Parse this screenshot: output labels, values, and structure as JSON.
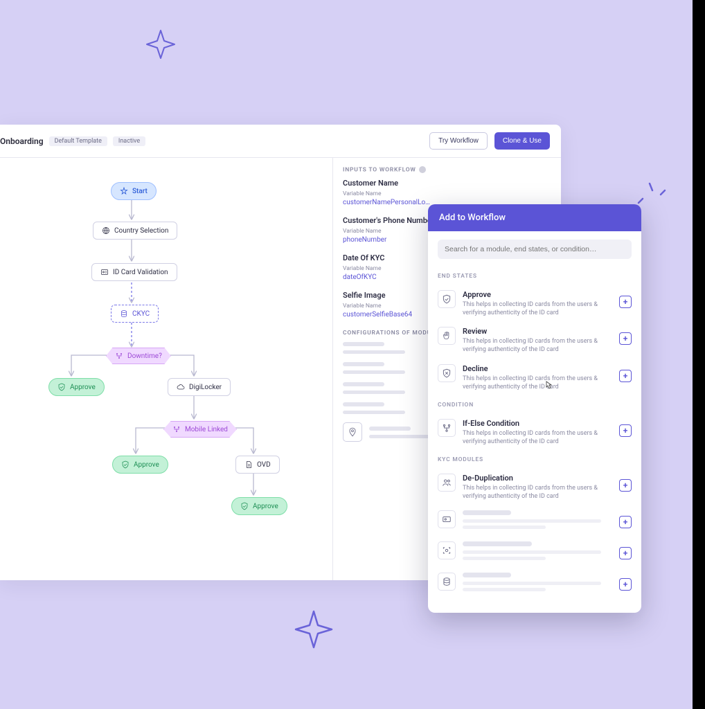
{
  "header": {
    "title": "Onboarding",
    "badges": [
      "Default Template",
      "Inactive"
    ],
    "try_label": "Try Workflow",
    "clone_label": "Clone & Use"
  },
  "canvas": {
    "start": "Start",
    "country": "Country Selection",
    "idcard": "ID Card Validation",
    "ckyc": "CKYC",
    "downtime": "Downtime?",
    "approve1": "Approve",
    "digilocker": "DigiLocker",
    "mobile_linked": "Mobile Linked",
    "approve2": "Approve",
    "ovd": "OVD",
    "approve3": "Approve"
  },
  "right_panel": {
    "section1_title": "INPUTS TO WORKFLOW",
    "inputs": [
      {
        "label": "Customer Name",
        "varlabel": "Variable Name",
        "value": "customerNamePersonalLo…"
      },
      {
        "label": "Customer's Phone Number",
        "varlabel": "Variable Name",
        "value": "phoneNumber"
      },
      {
        "label": "Date Of KYC",
        "varlabel": "Variable Name",
        "value": "dateOfKYC"
      },
      {
        "label": "Selfie Image",
        "varlabel": "Variable Name",
        "value": "customerSelfieBase64"
      }
    ],
    "section2_title": "CONFIGURATIONS OF MODULE"
  },
  "add_panel": {
    "title": "Add to Workflow",
    "search_placeholder": "Search for a module, end states, or condition…",
    "sections": {
      "end_states": "END STATES",
      "condition": "CONDITION",
      "kyc_modules": "KYC MODULES"
    },
    "modules": {
      "approve": {
        "title": "Approve",
        "desc": "This helps in collecting ID cards from the users & verifying authenticity of the ID card"
      },
      "review": {
        "title": "Review",
        "desc": "This helps in collecting ID cards from the users & verifying authenticity of the ID card"
      },
      "decline": {
        "title": "Decline",
        "desc": "This helps in collecting ID cards from the users & verifying authenticity of the ID card"
      },
      "ifelse": {
        "title": "If-Else Condition",
        "desc": "This helps in collecting ID cards from the users & verifying authenticity of the ID card"
      },
      "dedup": {
        "title": "De-Duplication",
        "desc": "This helps in collecting ID cards from the users & verifying authenticity of the ID card"
      }
    }
  },
  "colors": {
    "accent": "#5b54d6"
  }
}
